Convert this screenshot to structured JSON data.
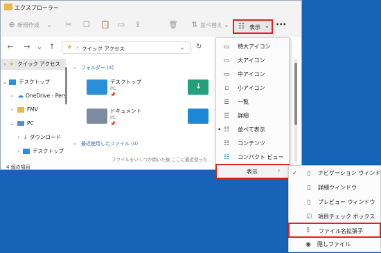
{
  "window": {
    "title": "エクスプローラー"
  },
  "toolbar": {
    "new_label": "新規作成",
    "sort_label": "並べ替え",
    "view_label": "表示",
    "more_label": "•••"
  },
  "address": {
    "path": "クイック アクセス"
  },
  "sidebar": {
    "items": [
      {
        "label": "クイック アクセス"
      },
      {
        "label": "デスクトップ"
      },
      {
        "label": "OneDrive - Pers"
      },
      {
        "label": "FMV"
      },
      {
        "label": "PC"
      },
      {
        "label": "ダウンロード"
      },
      {
        "label": "デスクトップ"
      }
    ]
  },
  "content": {
    "folders_header": "フォルダー (4)",
    "recent_header": "最近使用したファイル (0)",
    "recent_note": "ファイルをいくつか開いた後 ここに最近使った",
    "folders": [
      {
        "name": "デスクトップ",
        "sub": "PC"
      },
      {
        "name": "ドキュメント",
        "sub": "PC"
      }
    ]
  },
  "status": {
    "text": "4 個の項目"
  },
  "view_menu": {
    "items": [
      {
        "label": "特大アイコン",
        "icon": "monitor-icon"
      },
      {
        "label": "大アイコン",
        "icon": "monitor-icon"
      },
      {
        "label": "中アイコン",
        "icon": "monitor-icon"
      },
      {
        "label": "小アイコン",
        "icon": "small-grid-icon"
      },
      {
        "label": "一覧",
        "icon": "list-icon"
      },
      {
        "label": "詳細",
        "icon": "details-icon"
      },
      {
        "label": "並べて表示",
        "icon": "tiles-icon"
      },
      {
        "label": "コンテンツ",
        "icon": "content-icon"
      },
      {
        "label": "コンパクト ビュー",
        "icon": "compact-icon"
      }
    ],
    "show_label": "表示"
  },
  "show_submenu": {
    "items": [
      {
        "label": "ナビゲーション ウィンドウ"
      },
      {
        "label": "詳細ウィンドウ"
      },
      {
        "label": "プレビュー ウィンドウ"
      },
      {
        "label": "項目チェック ボックス"
      },
      {
        "label": "ファイル名拡張子"
      },
      {
        "label": "隠しファイル"
      }
    ]
  },
  "colors": {
    "accent": "#e0201f",
    "desktop_bg": "#1663b8",
    "link": "#2b6cb0"
  }
}
